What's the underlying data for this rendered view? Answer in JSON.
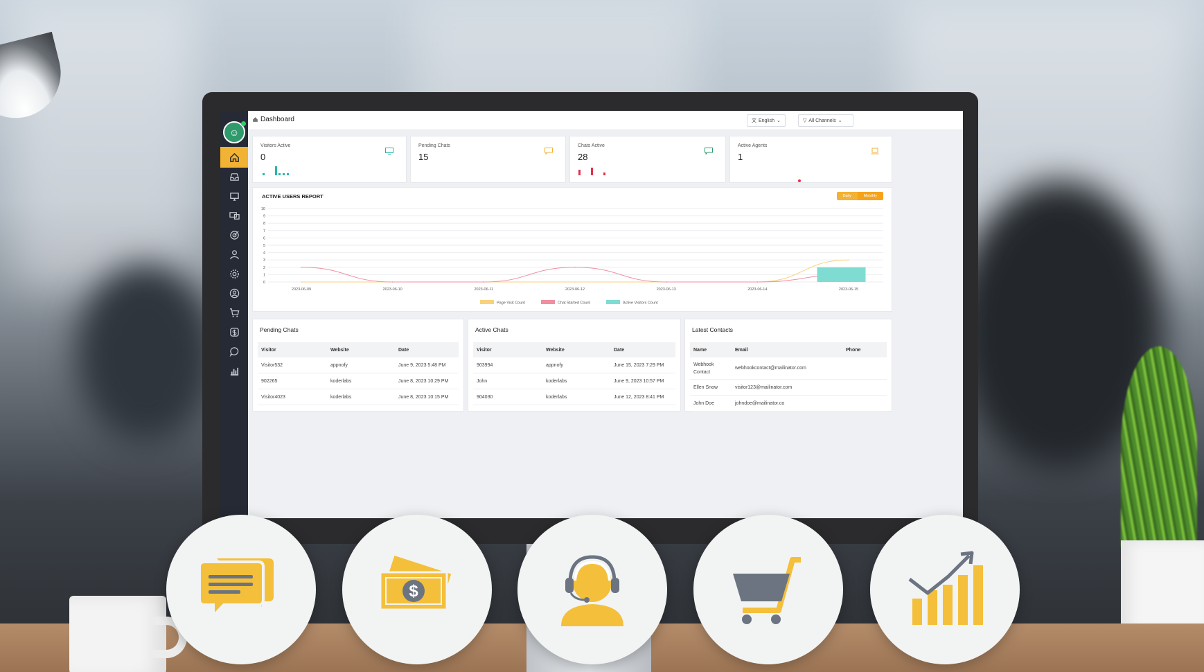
{
  "app": {
    "breadcrumb": "Dashboard",
    "language_label": "English",
    "channels_label": "All Channels"
  },
  "sidebar": {
    "items": [
      {
        "icon": "home-icon"
      },
      {
        "icon": "inbox-icon"
      },
      {
        "icon": "monitor-icon"
      },
      {
        "icon": "screens-icon"
      },
      {
        "icon": "target-icon"
      },
      {
        "icon": "user-icon"
      },
      {
        "icon": "settings-icon"
      },
      {
        "icon": "user-circle-icon"
      },
      {
        "icon": "cart-icon"
      },
      {
        "icon": "dollar-icon"
      },
      {
        "icon": "chat-icon"
      },
      {
        "icon": "analytics-icon"
      }
    ]
  },
  "stats": [
    {
      "label": "Visitors Active",
      "value": "0",
      "icon": "monitor-icon",
      "color": "#2bb5a6"
    },
    {
      "label": "Pending Chats",
      "value": "15",
      "icon": "chat-icon",
      "color": "#f2b233"
    },
    {
      "label": "Chats Active",
      "value": "28",
      "icon": "chat-icon",
      "color": "#2f9a6b"
    },
    {
      "label": "Active Agents",
      "value": "1",
      "icon": "laptop-icon",
      "color": "#f2b233"
    }
  ],
  "report": {
    "title": "ACTIVE USERS REPORT",
    "toggle_daily": "Daily",
    "toggle_monthly": "Monthly"
  },
  "chart_data": {
    "type": "line",
    "title": "ACTIVE USERS REPORT",
    "categories": [
      "2023-06-09",
      "2023-06-10",
      "2023-06-11",
      "2023-06-12",
      "2023-06-13",
      "2023-06-14",
      "2023-06-15"
    ],
    "ylim": [
      0,
      10
    ],
    "yticks": [
      0,
      1,
      2,
      3,
      4,
      5,
      6,
      7,
      8,
      9,
      10
    ],
    "series": [
      {
        "name": "Page Visit Count",
        "type": "line",
        "color": "#f8d27c",
        "values": [
          0,
          0,
          0,
          0,
          0,
          0,
          3
        ]
      },
      {
        "name": "Chat Started Count",
        "type": "line",
        "color": "#f08fa0",
        "values": [
          2,
          0,
          0,
          2,
          0,
          0,
          1
        ]
      },
      {
        "name": "Active Visitors Count",
        "type": "bar",
        "color": "#7fdcd3",
        "values": [
          0,
          0,
          0,
          0,
          0,
          0,
          2
        ]
      }
    ],
    "grid": true,
    "legend": "bottom"
  },
  "pending_chats": {
    "title": "Pending Chats",
    "columns": [
      "Visitor",
      "Website",
      "Date"
    ],
    "rows": [
      [
        "Visitor532",
        "appnofy",
        "June 9, 2023 5:48 PM"
      ],
      [
        "902265",
        "koderlabs",
        "June 8, 2023 10:29 PM"
      ],
      [
        "Visitor4023",
        "koderlabs",
        "June 8, 2023 10:15 PM"
      ]
    ]
  },
  "active_chats": {
    "title": "Active Chats",
    "columns": [
      "Visitor",
      "Website",
      "Date"
    ],
    "rows": [
      [
        "903994",
        "appnofy",
        "June 15, 2023 7:29 PM"
      ],
      [
        "John",
        "koderlabs",
        "June 9, 2023 10:57 PM"
      ],
      [
        "904030",
        "koderlabs",
        "June 12, 2023 8:41 PM"
      ]
    ]
  },
  "latest_contacts": {
    "title": "Latest Contacts",
    "columns": [
      "Name",
      "Email",
      "Phone"
    ],
    "rows": [
      [
        "Webhook Contact",
        "webhookcontact@mailinator.com",
        ""
      ],
      [
        "Ellen Snow",
        "visitor123@mailinator.com",
        ""
      ],
      [
        "John Doe",
        "johndoe@mailinator.co",
        ""
      ]
    ]
  },
  "features": [
    {
      "icon": "chat-bubbles-icon"
    },
    {
      "icon": "money-icon"
    },
    {
      "icon": "support-agent-icon"
    },
    {
      "icon": "shopping-cart-icon"
    },
    {
      "icon": "growth-chart-icon"
    }
  ],
  "colors": {
    "accent": "#f2b233",
    "sidebar": "#262a35",
    "icon_gray": "#6b7480"
  }
}
